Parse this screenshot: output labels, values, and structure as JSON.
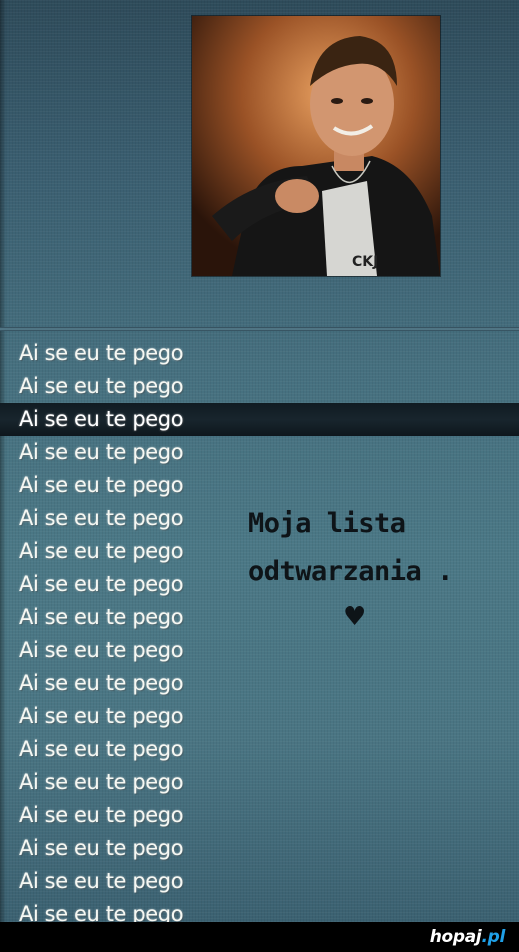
{
  "playlist": {
    "selected_index": 2,
    "items": [
      "Ai se eu te pego",
      "Ai se eu te pego",
      "Ai se eu te pego",
      "Ai se eu te pego",
      "Ai se eu te pego",
      "Ai se eu te pego",
      "Ai se eu te pego",
      "Ai se eu te pego",
      "Ai se eu te pego",
      "Ai se eu te pego",
      "Ai se eu te pego",
      "Ai se eu te pego",
      "Ai se eu te pego",
      "Ai se eu te pego",
      "Ai se eu te pego",
      "Ai se eu te pego",
      "Ai se eu te pego",
      "Ai se eu te pego"
    ]
  },
  "album_art": {
    "shirt_text": "CKJ"
  },
  "caption": {
    "line1": "Moja lista",
    "line2": "odtwarzania .",
    "heart": "♥"
  },
  "watermark": {
    "name": "hopaj",
    "tld": ".pl"
  },
  "colors": {
    "screen_bg": "#46707f",
    "selected_row_bg": "#141f26",
    "text": "#f6f8f3",
    "caption_text": "#0e1418",
    "watermark_accent": "#1fa0e8"
  }
}
